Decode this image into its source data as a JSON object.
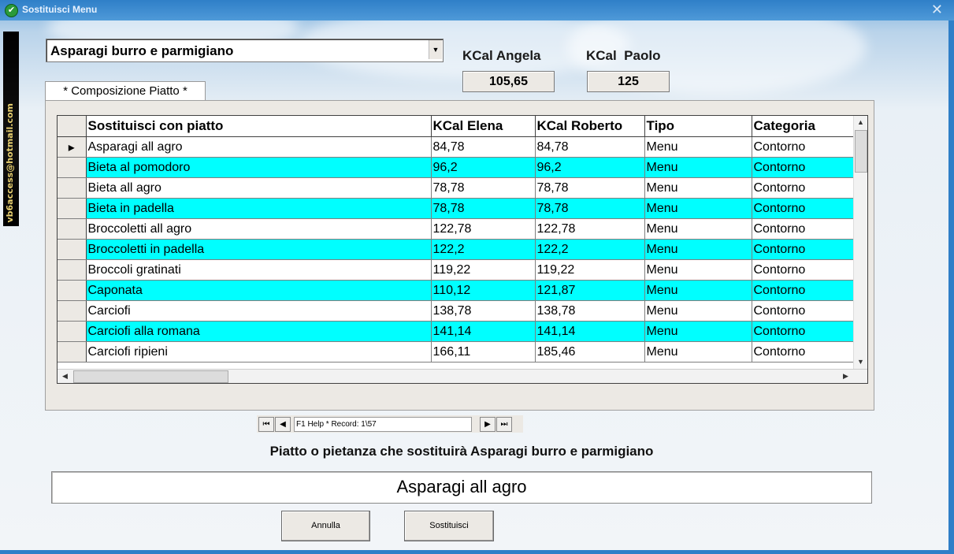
{
  "window": {
    "title": "Sostituisci Menu",
    "close_icon": "close-icon"
  },
  "sidebar_watermark": "vb6access@hotmail.com",
  "dish_combo": {
    "value": "Asparagi burro e parmigiano"
  },
  "kcal": {
    "angela_label": "KCal Angela",
    "angela_value": "105,65",
    "paolo_label": "KCal  Paolo",
    "paolo_value": "125"
  },
  "tab": {
    "label": "* Composizione Piatto *"
  },
  "grid": {
    "columns": [
      "Sostituisci con piatto",
      "KCal Elena",
      "KCal Roberto",
      "Tipo",
      "Categoria"
    ],
    "rows": [
      [
        "Asparagi all agro",
        "84,78",
        "84,78",
        "Menu",
        "Contorno"
      ],
      [
        "Bieta al pomodoro",
        "96,2",
        "96,2",
        "Menu",
        "Contorno"
      ],
      [
        "Bieta all agro",
        "78,78",
        "78,78",
        "Menu",
        "Contorno"
      ],
      [
        "Bieta in padella",
        "78,78",
        "78,78",
        "Menu",
        "Contorno"
      ],
      [
        "Broccoletti all agro",
        "122,78",
        "122,78",
        "Menu",
        "Contorno"
      ],
      [
        "Broccoletti in padella",
        "122,2",
        "122,2",
        "Menu",
        "Contorno"
      ],
      [
        "Broccoli gratinati",
        "119,22",
        "119,22",
        "Menu",
        "Contorno"
      ],
      [
        "Caponata",
        "110,12",
        "121,87",
        "Menu",
        "Contorno"
      ],
      [
        "Carciofi",
        "138,78",
        "138,78",
        "Menu",
        "Contorno"
      ],
      [
        "Carciofi alla romana",
        "141,14",
        "141,14",
        "Menu",
        "Contorno"
      ],
      [
        "Carciofi ripieni",
        "166,11",
        "185,46",
        "Menu",
        "Contorno"
      ]
    ],
    "current_row_icon": "record-pointer-icon"
  },
  "navigator": {
    "text": "F1 Help    *    Record: 1\\57"
  },
  "caption": "Piatto o pietanza che sostituirà Asparagi burro e parmigiano",
  "result_value": "Asparagi all agro",
  "buttons": {
    "cancel": "Annulla",
    "replace": "Sostituisci"
  }
}
